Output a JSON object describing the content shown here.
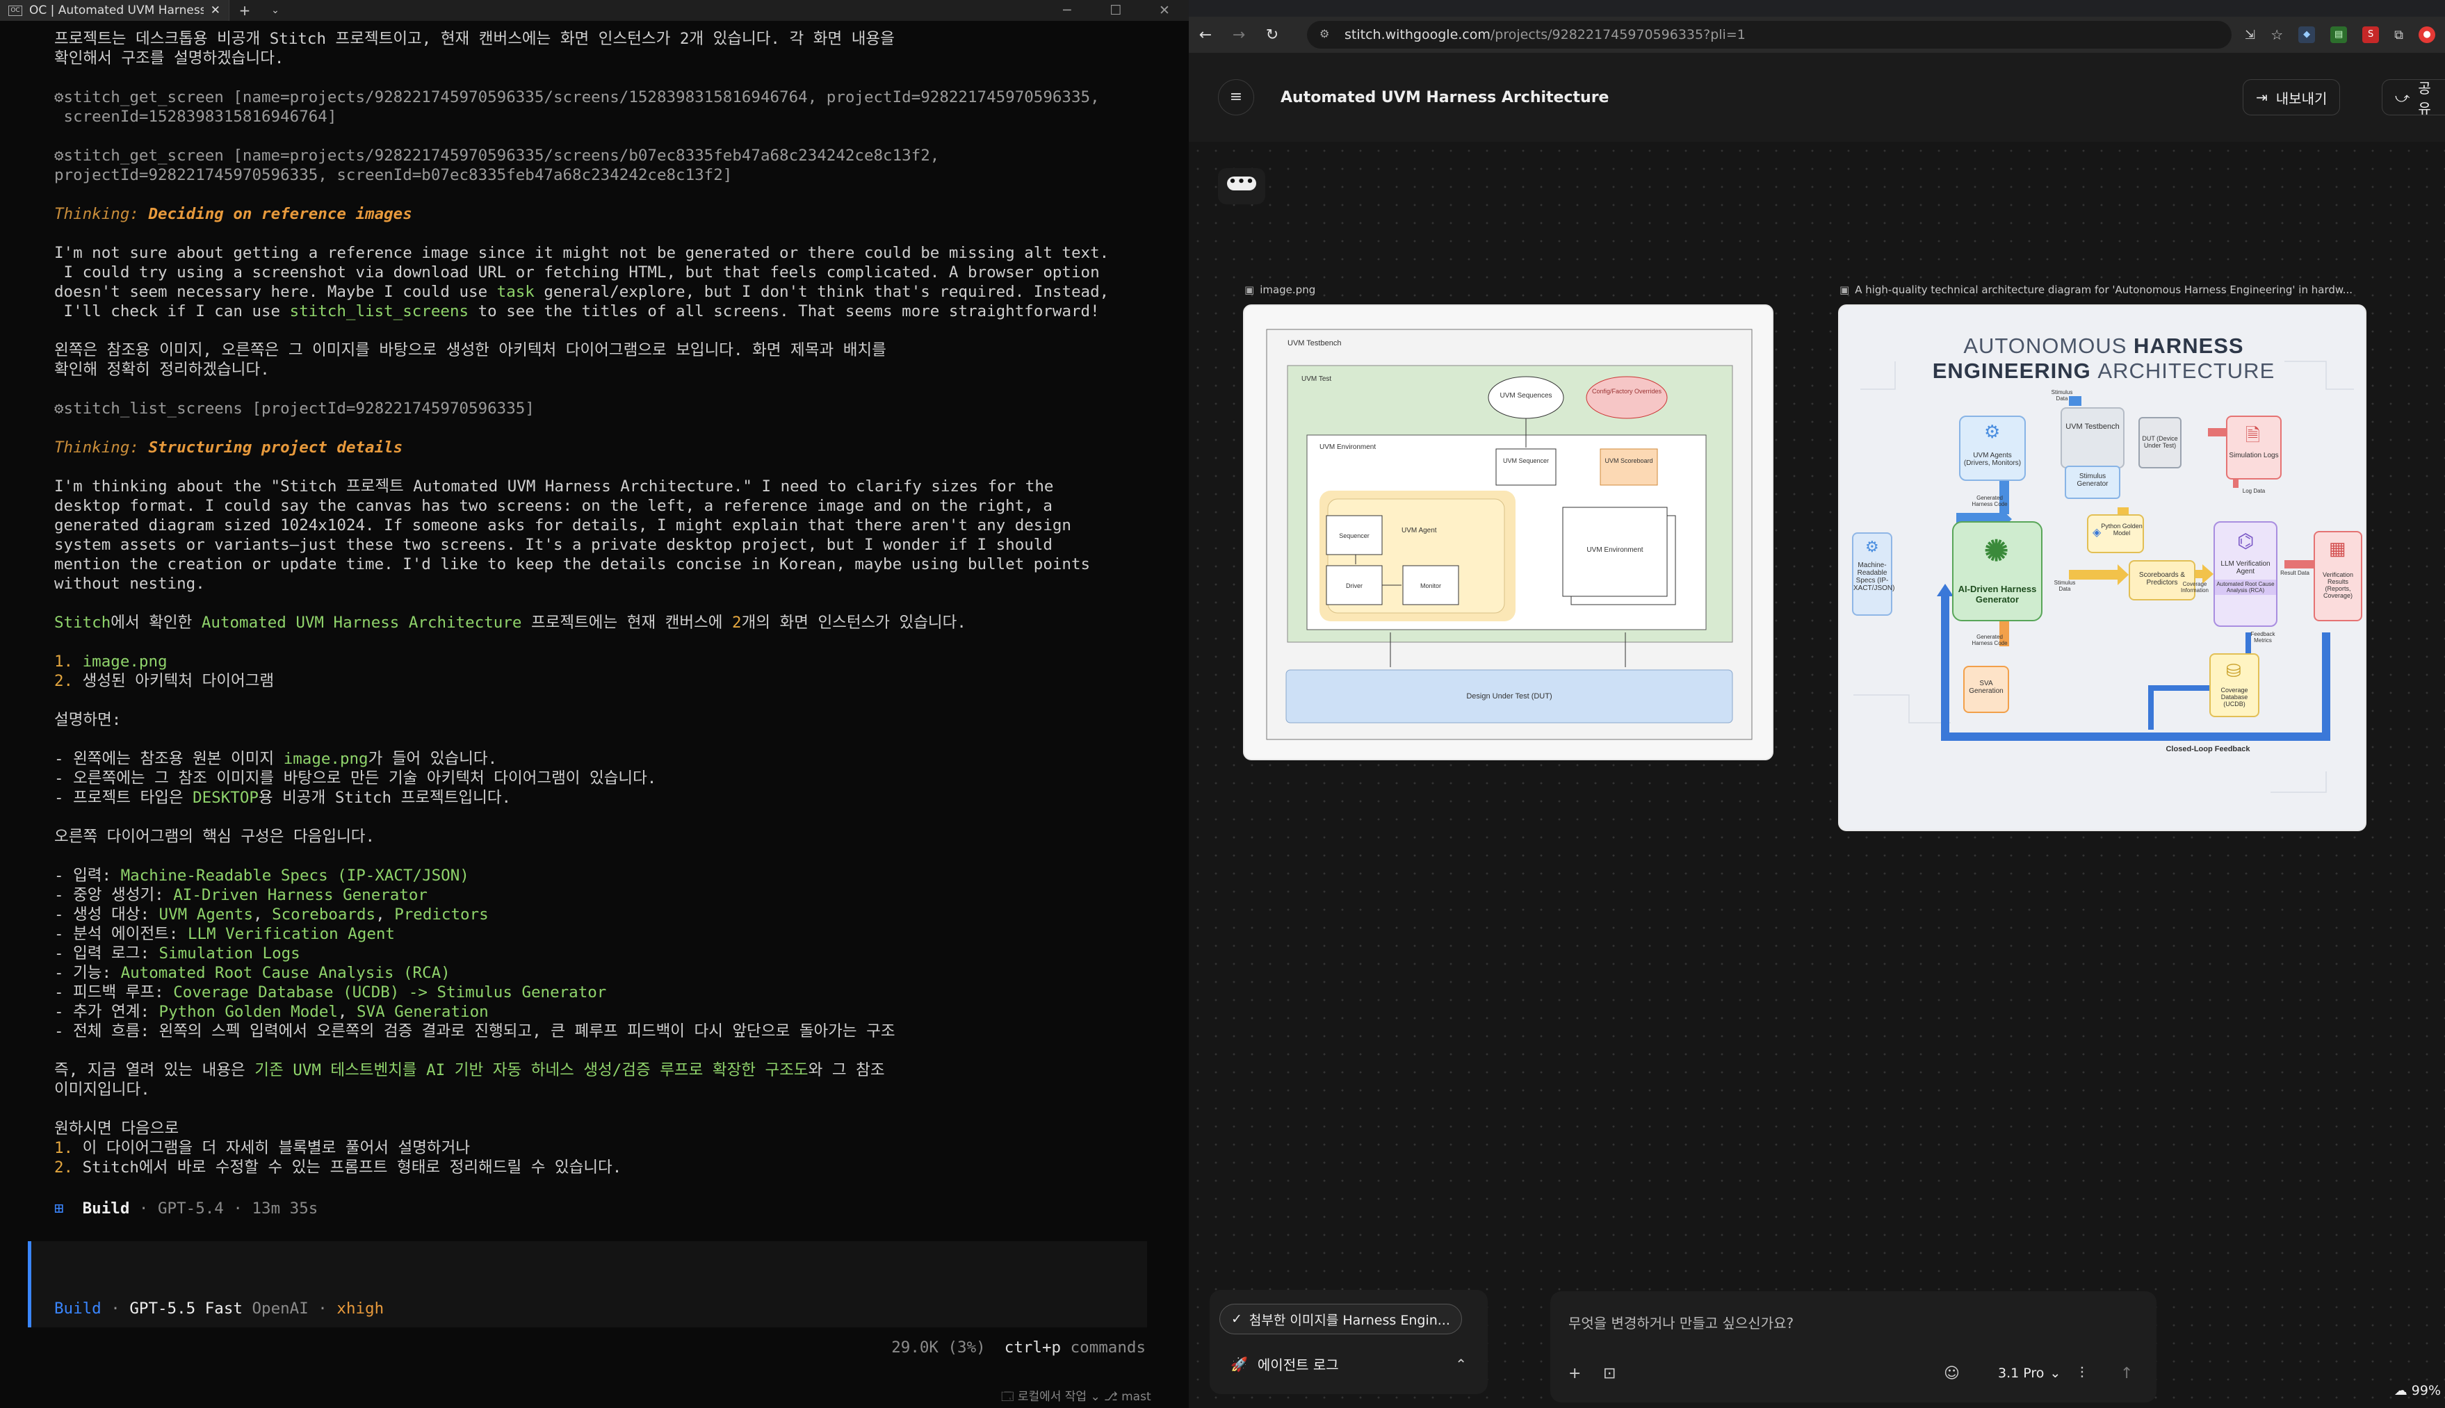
{
  "terminal": {
    "tab_title": "OC | Automated UVM Harness",
    "tab_icon": "OC",
    "lines": [
      {
        "t": "plain",
        "s": "프로젝트는 데스크톱용 비공개 Stitch 프로젝트이고, 현재 캔버스에는 화면 인스턴스가 2개 있습니다. 각 화면 내용을"
      },
      {
        "t": "plain",
        "s": "확인해서 구조를 설명하겠습니다."
      },
      {
        "t": "gap"
      },
      {
        "t": "tool",
        "s": "⚙stitch_get_screen [name=projects/9282217459705963​35/screens/15283983158169467​64, projectId=928221745970596335,"
      },
      {
        "t": "tool",
        "s": " screenId=1528398315816946764]"
      },
      {
        "t": "gap"
      },
      {
        "t": "tool",
        "s": "⚙stitch_get_screen [name=projects/928221745970596335/screens/b07ec8335feb47a68c234242ce8c13f2,"
      },
      {
        "t": "tool",
        "s": "projectId=928221745970596335, screenId=b07ec8335feb47a68c234242ce8c13f2]"
      },
      {
        "t": "gap"
      },
      {
        "t": "think",
        "a": "Thinking: ",
        "b": "Deciding on reference images"
      },
      {
        "t": "gap"
      },
      {
        "t": "plain",
        "s": "I'm not sure about getting a reference image since it might not be generated or there could be missing alt text."
      },
      {
        "t": "plain",
        "s": " I could try using a screenshot via download URL or fetching HTML, but that feels complicated. A browser option"
      },
      {
        "t": "mix",
        "parts": [
          [
            "doesn't seem necessary here. Maybe I could use ",
            ""
          ],
          [
            "task",
            "g"
          ],
          [
            " general/explore, but I don't think that's required. Instead,",
            ""
          ]
        ]
      },
      {
        "t": "mix",
        "parts": [
          [
            " I'll check if I can use ",
            ""
          ],
          [
            "stitch_list_screens",
            "g"
          ],
          [
            " to see the titles of all screens. That seems more straightforward!",
            ""
          ]
        ]
      },
      {
        "t": "gap"
      },
      {
        "t": "plain",
        "s": "왼쪽은 참조용 이미지, 오른쪽은 그 이미지를 바탕으로 생성한 아키텍처 다이어그램으로 보입니다. 화면 제목과 배치를"
      },
      {
        "t": "plain",
        "s": "확인해 정확히 정리하겠습니다."
      },
      {
        "t": "gap"
      },
      {
        "t": "tool",
        "s": "⚙stitch_list_screens [projectId=928221745970596335]"
      },
      {
        "t": "gap"
      },
      {
        "t": "think",
        "a": "Thinking: ",
        "b": "Structuring project details"
      },
      {
        "t": "gap"
      },
      {
        "t": "plain",
        "s": "I'm thinking about the \"Stitch 프로젝트 Automated UVM Harness Architecture.\" I need to clarify sizes for the"
      },
      {
        "t": "plain",
        "s": "desktop format. I could say the canvas has two screens: on the left, a reference image and on the right, a"
      },
      {
        "t": "plain",
        "s": "generated diagram sized 1024x1024. If someone asks for details, I might explain that there aren't any design"
      },
      {
        "t": "plain",
        "s": "system assets or variants—just these two screens. It's a private desktop project, but I wonder if I should"
      },
      {
        "t": "plain",
        "s": "mention the creation or update time. I'd like to keep the details concise in Korean, maybe using bullet points"
      },
      {
        "t": "plain",
        "s": "without nesting."
      },
      {
        "t": "gap"
      },
      {
        "t": "mix",
        "parts": [
          [
            "Stitch",
            "g"
          ],
          [
            "에서 확인한 ",
            ""
          ],
          [
            "Automated UVM Harness Architecture",
            "g"
          ],
          [
            " 프로젝트에는 현재 캔버스에 ",
            ""
          ],
          [
            "2",
            "o"
          ],
          [
            "개의 화면 인스턴스가 있습니다.",
            ""
          ]
        ]
      },
      {
        "t": "gap"
      },
      {
        "t": "mix",
        "parts": [
          [
            "1. ",
            "o"
          ],
          [
            "image.png",
            "g"
          ]
        ]
      },
      {
        "t": "mix",
        "parts": [
          [
            "2. ",
            "o"
          ],
          [
            "생성된 아키텍처 다이어그램",
            ""
          ]
        ]
      },
      {
        "t": "gap"
      },
      {
        "t": "plain",
        "s": "설명하면:"
      },
      {
        "t": "gap"
      },
      {
        "t": "mix",
        "parts": [
          [
            "- 왼쪽에는 참조용 원본 이미지 ",
            ""
          ],
          [
            "image.png",
            "g"
          ],
          [
            "가 들어 있습니다.",
            ""
          ]
        ]
      },
      {
        "t": "plain",
        "s": "- 오른쪽에는 그 참조 이미지를 바탕으로 만든 기술 아키텍처 다이어그램이 있습니다."
      },
      {
        "t": "mix",
        "parts": [
          [
            "- 프로젝트 타입은 ",
            ""
          ],
          [
            "DESKTOP",
            "g"
          ],
          [
            "용 비공개 Stitch 프로젝트입니다.",
            ""
          ]
        ]
      },
      {
        "t": "gap"
      },
      {
        "t": "plain",
        "s": "오른쪽 다이어그램의 핵심 구성은 다음입니다."
      },
      {
        "t": "gap"
      },
      {
        "t": "mix",
        "parts": [
          [
            "- 입력: ",
            ""
          ],
          [
            "Machine-Readable Specs (IP-XACT/JSON)",
            "g"
          ]
        ]
      },
      {
        "t": "mix",
        "parts": [
          [
            "- 중앙 생성기: ",
            ""
          ],
          [
            "AI-Driven Harness Generator",
            "g"
          ]
        ]
      },
      {
        "t": "mix",
        "parts": [
          [
            "- 생성 대상: ",
            ""
          ],
          [
            "UVM Agents",
            "g"
          ],
          [
            ", ",
            ""
          ],
          [
            "Scoreboards",
            "g"
          ],
          [
            ", ",
            ""
          ],
          [
            "Predictors",
            "g"
          ]
        ]
      },
      {
        "t": "mix",
        "parts": [
          [
            "- 분석 에이전트: ",
            ""
          ],
          [
            "LLM Verification Agent",
            "g"
          ]
        ]
      },
      {
        "t": "mix",
        "parts": [
          [
            "- 입력 로그: ",
            ""
          ],
          [
            "Simulation Logs",
            "g"
          ]
        ]
      },
      {
        "t": "mix",
        "parts": [
          [
            "- 기능: ",
            ""
          ],
          [
            "Automated Root Cause Analysis (RCA)",
            "g"
          ]
        ]
      },
      {
        "t": "mix",
        "parts": [
          [
            "- 피드백 루프: ",
            ""
          ],
          [
            "Coverage Database (UCDB) -> Stimulus Generator",
            "g"
          ]
        ]
      },
      {
        "t": "mix",
        "parts": [
          [
            "- 추가 연계: ",
            ""
          ],
          [
            "Python Golden Model",
            "g"
          ],
          [
            ", ",
            ""
          ],
          [
            "SVA Generation",
            "g"
          ]
        ]
      },
      {
        "t": "plain",
        "s": "- 전체 흐름: 왼쪽의 스펙 입력에서 오른쪽의 검증 결과로 진행되고, 큰 폐루프 피드백이 다시 앞단으로 돌아가는 구조"
      },
      {
        "t": "gap"
      },
      {
        "t": "mix",
        "parts": [
          [
            "즉, 지금 열려 있는 내용은 ",
            ""
          ],
          [
            "기존 UVM 테스트벤치를 AI 기반 자동 하네스 생성/검증 루프로 확장한 구조도",
            "g"
          ],
          [
            "와 그 참조",
            ""
          ]
        ]
      },
      {
        "t": "plain",
        "s": "이미지입니다."
      },
      {
        "t": "gap"
      },
      {
        "t": "plain",
        "s": "원하시면 다음으로"
      },
      {
        "t": "mix",
        "parts": [
          [
            "1. ",
            "o"
          ],
          [
            "이 다이어그램을 더 자세히 블록별로 풀어서 설명하거나",
            ""
          ]
        ]
      },
      {
        "t": "mix",
        "parts": [
          [
            "2. ",
            "o"
          ],
          [
            "Stitch에서 바로 수정할 수 있는 프롬프트 형태로 정리해드릴 수 있습니다.",
            ""
          ]
        ]
      }
    ],
    "build_status": {
      "label": "Build",
      "model": "GPT-5.4",
      "time": "13m 35s"
    },
    "input_meta": {
      "mode": "Build",
      "model": "GPT-5.5 Fast",
      "provider": "OpenAI",
      "variant": "xhigh"
    },
    "status_tokens": "29.0K (3%)",
    "status_shortcut": "ctrl+p",
    "status_shortcut_label": "commands",
    "bottom_strip": "🗔 로컬에서 작업 ⌄   ⎇ mast"
  },
  "browser": {
    "url_host": "stitch.withgoogle.com",
    "url_path": "/projects/928221745970596335?pli=1",
    "app_title": "Automated UVM Harness Architecture",
    "export_label": "내보내기",
    "share_label": "공유",
    "frame1_label": "image.png",
    "frame2_label": "A high-quality technical architecture diagram for 'Autonomous Harness Engineering' in hardw...",
    "chip_label": "첨부한 이미지를 Harness Engin...",
    "agent_log_label": "에이전트 로그",
    "prompt_placeholder": "무엇을 변경하거나 만들고 싶으신가요?",
    "model_label": "3.1 Pro",
    "zoom": "99%"
  },
  "diagram1": {
    "testbench": "UVM Testbench",
    "test": "UVM Test",
    "sequences": "UVM Sequences",
    "config": "Config/Factory Overrides",
    "env": "UVM Environment",
    "sequencer_top": "UVM Sequencer",
    "scoreboard": "UVM Scoreboard",
    "agent": "UVM Agent",
    "sequencer": "Sequencer",
    "driver": "Driver",
    "monitor": "Monitor",
    "env2": "UVM Environment",
    "dut": "Design Under Test (DUT)"
  },
  "diagram2": {
    "title_a": "AUTONOMOUS ",
    "title_b": "HARNESS",
    "title_c": "ENGINEERING ",
    "title_d": "ARCHITECTURE",
    "specs": "Machine-Readable Specs (IP-XACT/JSON)",
    "generator": "AI-Driven Harness Generator",
    "agents": "UVM Agents (Drivers, Monitors)",
    "testbench": "UVM Testbench",
    "stimgen": "Stimulus Generator",
    "dut": "DUT (Device Under Test)",
    "simlogs": "Simulation Logs",
    "golden": "Python Golden Model",
    "scoreboards": "Scoreboards & Predictors",
    "llm": "LLM Verification Agent",
    "rca": "Automated Root Cause Analysis (RCA)",
    "results": "Verification Results (Reports, Coverage)",
    "sva": "SVA Generation",
    "ucdb": "Coverage Database (UCDB)",
    "loop": "Closed-Loop Feedback",
    "l_stim": "Stimulus Data",
    "l_gen1": "Generated Harness Code",
    "l_gen2": "Generated Harness Code",
    "l_log": "Log Data",
    "l_cov": "Coverage Information",
    "l_result": "Result Data",
    "l_fb": "Feedback Metrics",
    "l_stim2": "Stimulus Data"
  }
}
